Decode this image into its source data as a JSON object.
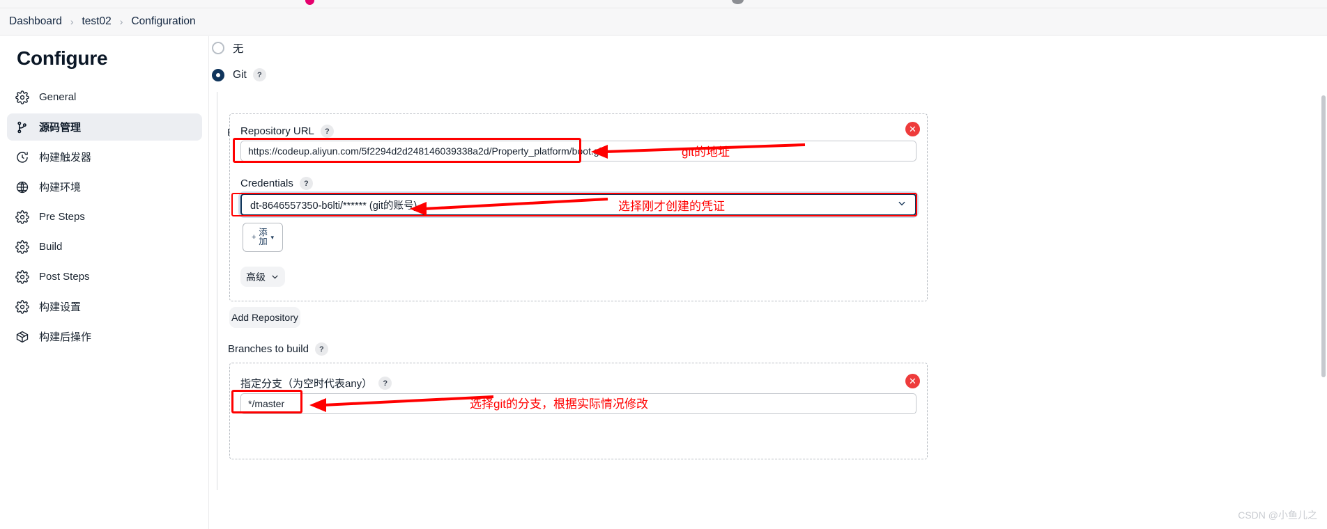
{
  "breadcrumb": {
    "items": [
      "Dashboard",
      "test02",
      "Configuration"
    ],
    "separator": "›"
  },
  "sidebar": {
    "title": "Configure",
    "items": [
      {
        "label": "General",
        "icon": "gear-icon",
        "active": false
      },
      {
        "label": "源码管理",
        "icon": "branch-icon",
        "active": true
      },
      {
        "label": "构建触发器",
        "icon": "clock-icon",
        "active": false
      },
      {
        "label": "构建环境",
        "icon": "globe-icon",
        "active": false
      },
      {
        "label": "Pre Steps",
        "icon": "gear-icon",
        "active": false
      },
      {
        "label": "Build",
        "icon": "gear-icon",
        "active": false
      },
      {
        "label": "Post Steps",
        "icon": "gear-icon",
        "active": false
      },
      {
        "label": "构建设置",
        "icon": "gear-icon",
        "active": false
      },
      {
        "label": "构建后操作",
        "icon": "box-icon",
        "active": false
      }
    ]
  },
  "scm": {
    "radio_none": "无",
    "radio_git": "Git",
    "help_glyph": "?",
    "repositories_label": "Repositories",
    "repository_url_label": "Repository URL",
    "repository_url_value": "https://codeup.aliyun.com/5f2294d2d248146039338a2d/Property_platform/boot.git",
    "credentials_label": "Credentials",
    "credentials_value": "dt-8646557350-b6lti/****** (git的账号)",
    "credentials_chevron": "⌄",
    "add_button_label": "添加",
    "add_button_plus": "+",
    "add_button_caret": "▾",
    "advanced_button_label": "高级",
    "advanced_caret": "⌄",
    "add_repository_label": "Add Repository",
    "branches_label": "Branches to build",
    "branch_spec_label": "指定分支（为空时代表any）",
    "branch_value": "*/master",
    "delete_glyph": "✕"
  },
  "annotations": [
    {
      "text": "git的地址"
    },
    {
      "text": "选择刚才创建的凭证"
    },
    {
      "text": "选择git的分支，根据实际情况修改"
    }
  ],
  "watermark": "CSDN @小鱼儿之",
  "colors": {
    "accent": "#10355c",
    "annotation": "#ff0000",
    "sidebar_active": "#eceef2"
  }
}
